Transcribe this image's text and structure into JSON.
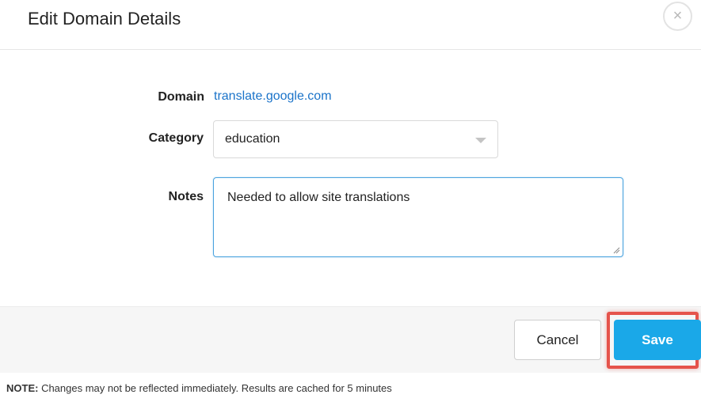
{
  "dialog": {
    "title": "Edit Domain Details",
    "close_symbol": "×",
    "close_icon": "close-icon"
  },
  "form": {
    "domain_label": "Domain",
    "domain_value": "translate.google.com",
    "category_label": "Category",
    "category_value": "education",
    "notes_label": "Notes",
    "notes_value": "Needed to allow site translations"
  },
  "footer": {
    "cancel_label": "Cancel",
    "save_label": "Save",
    "highlight_color": "#e5534b",
    "save_color": "#1aa8e8"
  },
  "note": {
    "prefix": "NOTE:",
    "text": " Changes may not be reflected immediately. Results are cached for 5 minutes"
  }
}
